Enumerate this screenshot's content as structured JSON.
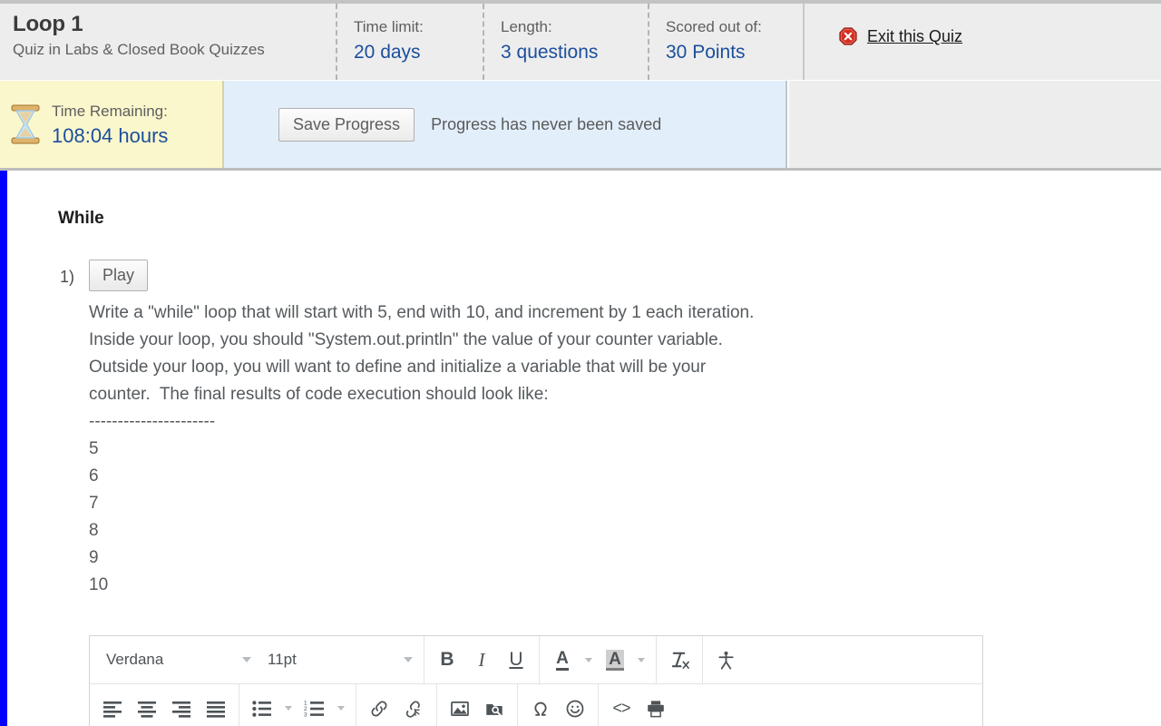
{
  "header": {
    "title": "Loop 1",
    "subtitle": "Quiz in Labs & Closed Book Quizzes",
    "stats": [
      {
        "label": "Time limit:",
        "value": "20 days"
      },
      {
        "label": "Length:",
        "value": "3 questions"
      },
      {
        "label": "Scored out of:",
        "value": "30 Points"
      }
    ],
    "exit_label": "Exit this Quiz",
    "exit_icon": "error-octagon-icon"
  },
  "timer": {
    "icon": "hourglass-icon",
    "label": "Time Remaining:",
    "value": "108:04 hours"
  },
  "progress": {
    "save_label": "Save Progress",
    "status": "Progress has never been saved"
  },
  "quiz": {
    "group_title": "While",
    "question_number": "1)",
    "play_label": "Play",
    "lines": [
      "Write a \"while\" loop that will start with 5, end with 10, and increment by 1 each iteration.",
      "Inside your loop, you should \"System.out.println\" the value of your counter variable.",
      "Outside your loop, you will want to define and initialize a variable that will be your",
      "counter.  The final results of code execution should look like:",
      "----------------------",
      "5",
      "6",
      "7",
      "8",
      "9",
      "10"
    ]
  },
  "editor": {
    "font_family_value": "Verdana",
    "font_size_value": "11pt",
    "row1": [
      {
        "name": "bold-icon",
        "glyph": "B"
      },
      {
        "name": "italic-icon",
        "glyph": "I"
      },
      {
        "name": "underline-icon",
        "glyph": "U"
      },
      {
        "name": "text-color-icon",
        "glyph": "A"
      },
      {
        "name": "highlight-color-icon",
        "glyph": "A"
      },
      {
        "name": "clear-formatting-icon",
        "glyph": "Tx"
      },
      {
        "name": "accessibility-checker-icon",
        "glyph": "person"
      }
    ],
    "row2": [
      {
        "name": "align-left-icon"
      },
      {
        "name": "align-center-icon"
      },
      {
        "name": "align-right-icon"
      },
      {
        "name": "align-justify-icon"
      },
      {
        "name": "bulleted-list-icon"
      },
      {
        "name": "numbered-list-icon"
      },
      {
        "name": "insert-link-icon"
      },
      {
        "name": "remove-link-icon"
      },
      {
        "name": "insert-image-icon"
      },
      {
        "name": "insert-document-icon"
      },
      {
        "name": "special-character-icon"
      },
      {
        "name": "emoji-icon"
      },
      {
        "name": "source-code-icon"
      },
      {
        "name": "print-icon"
      }
    ]
  },
  "colors": {
    "accent_blue": "#1b4f9c",
    "timer_bg": "#fbf7cd",
    "progress_bg": "#e2effb",
    "header_bg": "#ededed",
    "left_bar": "#0000ff",
    "exit_red": "#d42f22"
  }
}
